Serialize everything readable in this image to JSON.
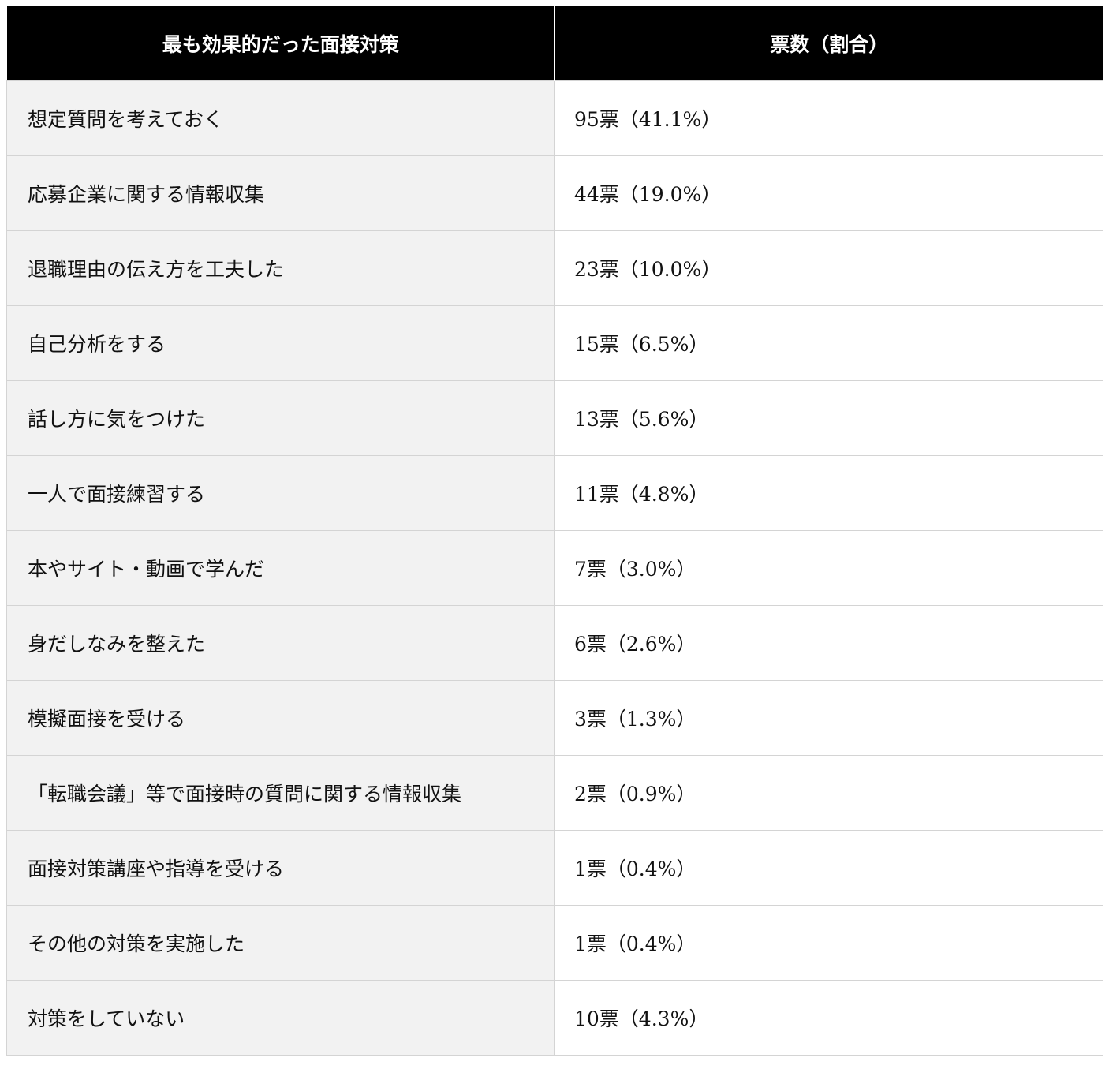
{
  "table": {
    "headers": [
      "最も効果的だった面接対策",
      "票数（割合）"
    ],
    "rows": [
      {
        "label": "想定質問を考えておく",
        "value": "95票（41.1%）"
      },
      {
        "label": "応募企業に関する情報収集",
        "value": "44票（19.0%）"
      },
      {
        "label": "退職理由の伝え方を工夫した",
        "value": "23票（10.0%）"
      },
      {
        "label": "自己分析をする",
        "value": "15票（6.5%）"
      },
      {
        "label": "話し方に気をつけた",
        "value": "13票（5.6%）"
      },
      {
        "label": "一人で面接練習する",
        "value": "11票（4.8%）"
      },
      {
        "label": "本やサイト・動画で学んだ",
        "value": "7票（3.0%）"
      },
      {
        "label": "身だしなみを整えた",
        "value": "6票（2.6%）"
      },
      {
        "label": "模擬面接を受ける",
        "value": "3票（1.3%）"
      },
      {
        "label": "「転職会議」等で面接時の質問に関する情報収集",
        "value": "2票（0.9%）"
      },
      {
        "label": "面接対策講座や指導を受ける",
        "value": "1票（0.4%）"
      },
      {
        "label": "その他の対策を実施した",
        "value": "1票（0.4%）"
      },
      {
        "label": "対策をしていない",
        "value": "10票（4.3%）"
      }
    ]
  }
}
